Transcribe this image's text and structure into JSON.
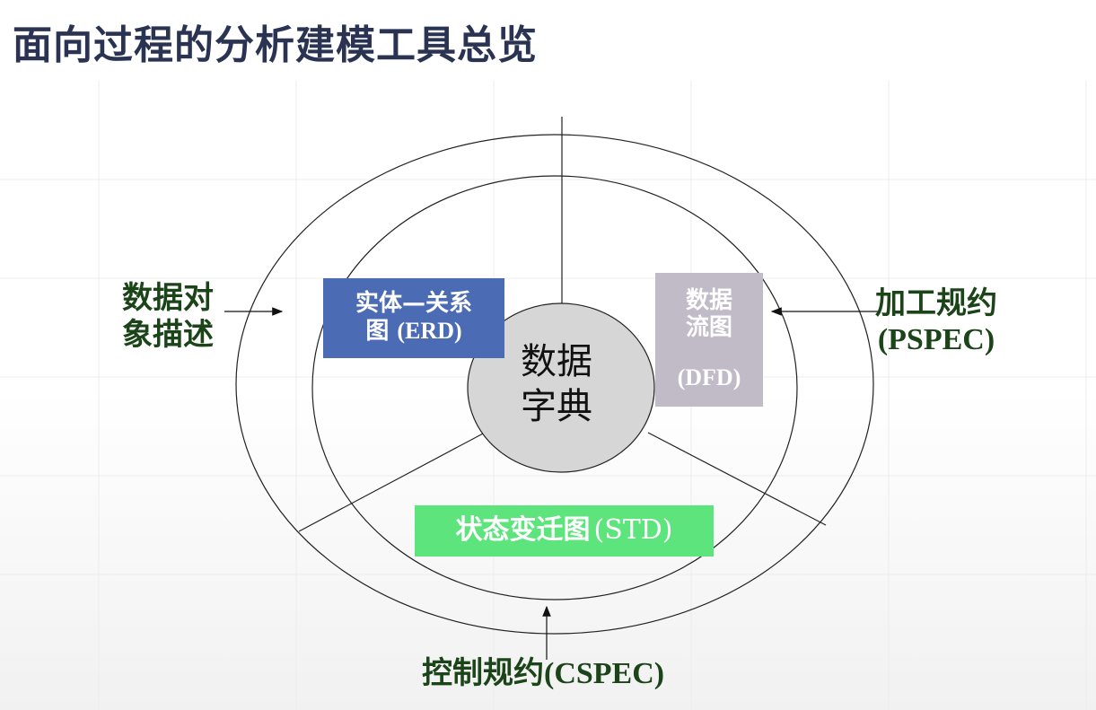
{
  "title": "面向过程的分析建模工具总览",
  "center": {
    "line1": "数据",
    "line2": "字典"
  },
  "erd": {
    "line1": "实体—关系",
    "line2_cn": "图",
    "line2_en": "(ERD)"
  },
  "dfd": {
    "line1": "数据",
    "line2": "流图",
    "line3": "(DFD)"
  },
  "std": {
    "cn": "状态变迁图",
    "en": "(STD)"
  },
  "left_label": {
    "line1": "数据对",
    "line2": "象描述"
  },
  "right_label": {
    "line1": "加工规约",
    "line2": "(PSPEC)"
  },
  "bottom_label": {
    "cn": "控制规约",
    "en": "(CSPEC)"
  },
  "colors": {
    "title": "#2a3352",
    "erd_box": "#4b6cb4",
    "dfd_box": "#c1bac7",
    "std_box": "#5de47c",
    "center_circle": "#d6d6d6",
    "side_labels": "#1b4519"
  }
}
